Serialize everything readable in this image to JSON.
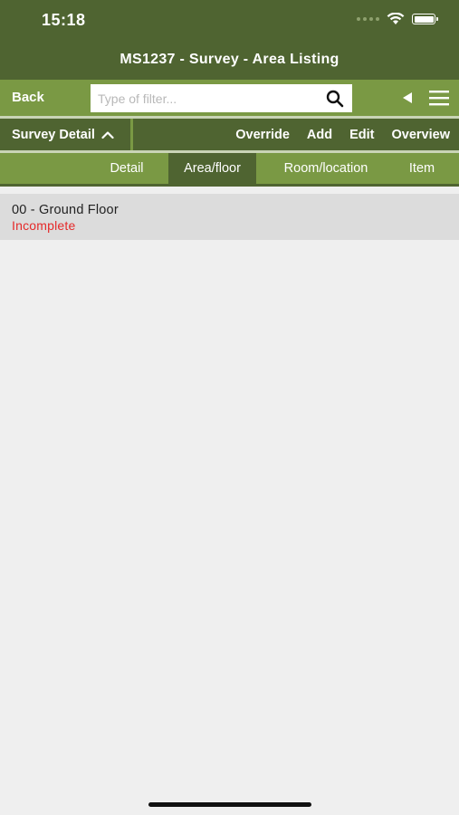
{
  "status_bar": {
    "time": "15:18"
  },
  "header": {
    "title": "MS1237 - Survey - Area Listing"
  },
  "toolbar": {
    "back_label": "Back",
    "search_placeholder": "Type of filter...",
    "search_value": ""
  },
  "actions": {
    "section_label": "Survey Detail",
    "links": [
      "Override",
      "Add",
      "Edit",
      "Overview"
    ]
  },
  "tabs": {
    "items": [
      "Detail",
      "Area/floor",
      "Room/location",
      "Item"
    ],
    "active": "Area/floor"
  },
  "list": {
    "items": [
      {
        "title": "00 - Ground Floor",
        "status": "Incomplete"
      }
    ]
  },
  "colors": {
    "dark_green": "#4f6431",
    "light_green": "#7a9944",
    "status_incomplete": "#e52a2a",
    "background": "#efefef"
  }
}
